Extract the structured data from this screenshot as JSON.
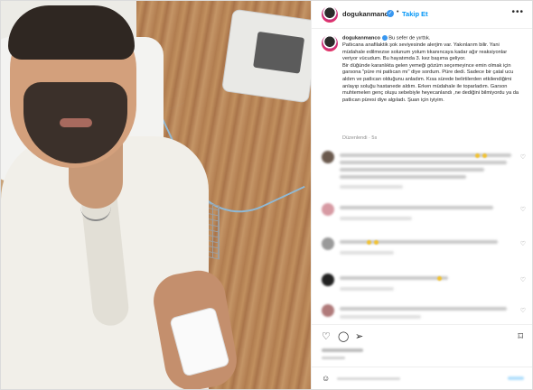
{
  "header": {
    "username": "dogukanmanco",
    "separator": "•",
    "follow_label": "Takip Et",
    "more_label": "•••"
  },
  "caption": {
    "username": "dogukanmanco",
    "line1": "Bu sefer de yırttık.",
    "paragraph1": "Patlıcana anafilaktik şok seviyesinde alerjim var. Yakınlarım bilir. Yani müdahale edilmezse solunum yolum tıkanıncaya kadar ağır reaksiyonlar veriyor vücudum. Bu hayatımda 3. kez başıma geliyor.",
    "paragraph2": "Bir düğünde karanlıkta gelen yemeği gözüm seçemeyince emin olmak için garsona \"püre mi patlıcan mı\" diye sordum. Püre dedi. Sadece bir çatal ucu aldım ve patlıcan olduğunu anladım. Kısa sürede belirtilerden etkilendiğimi anlayıp soluğu hastanede aldım. Erken müdahale ile toparladım. Garson muhtemelen genç oluşu sebebiyle heyecanlandı ,ne dediğini bilmiyordu ya da patlıcan püresi diye algıladı. Şuan için iyiyim.",
    "meta": "Düzenlendi · 5s"
  },
  "icons": {
    "verified": "verified-badge-icon",
    "more": "more-options-icon",
    "like": "heart-icon",
    "comment": "comment-icon",
    "share": "share-icon",
    "save": "bookmark-icon",
    "emoji": "emoji-icon"
  },
  "colors": {
    "link_blue": "#0095f6",
    "verified_blue": "#3897f0",
    "meta_gray": "#8e8e8e"
  }
}
